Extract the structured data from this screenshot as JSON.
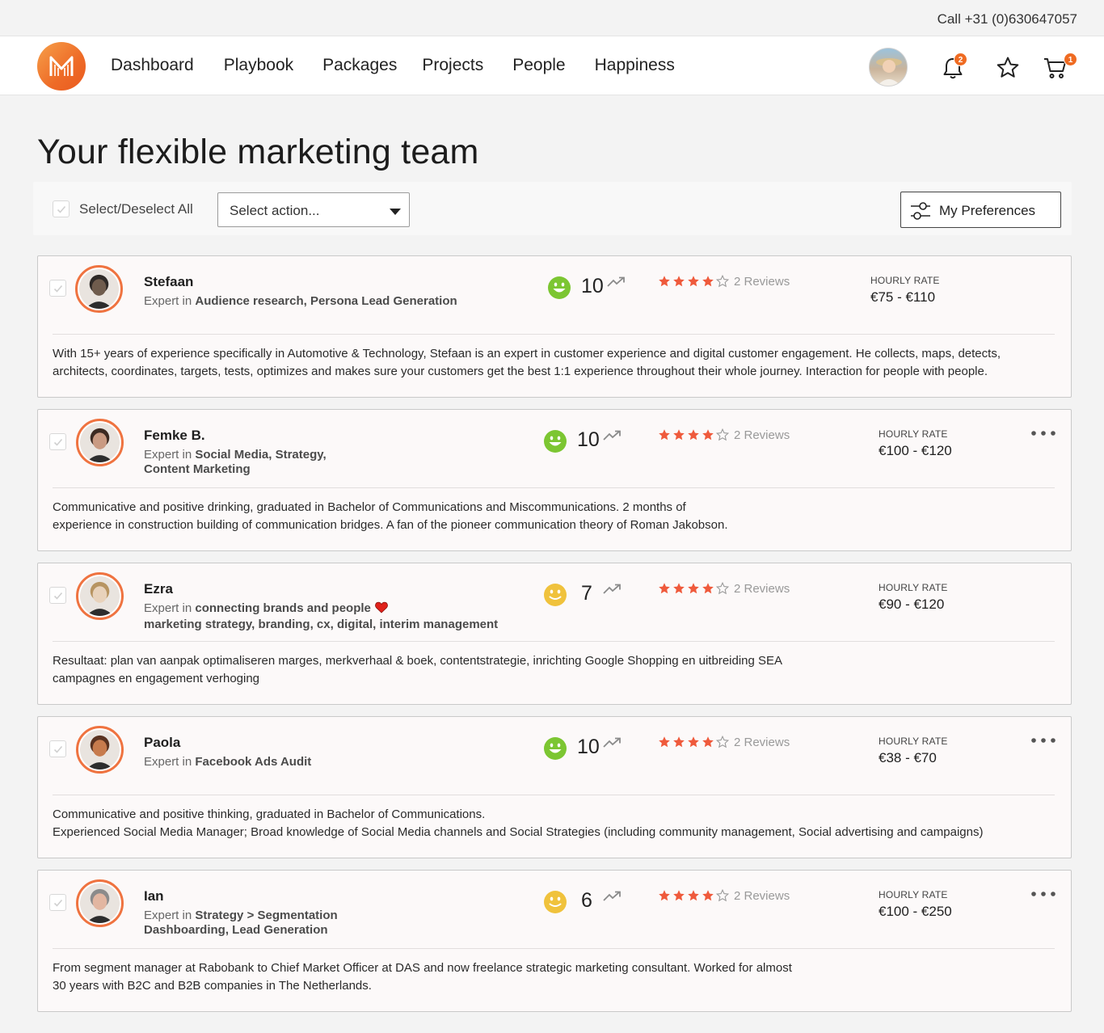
{
  "topbar": {
    "call": "Call +31 (0)630647057"
  },
  "nav": {
    "links": [
      "Dashboard",
      "Playbook",
      "Packages",
      "Projects",
      "People",
      "Happiness"
    ],
    "notifications_count": "2",
    "cart_count": "1",
    "accent": "#ef6b22"
  },
  "page": {
    "title": "Your flexible marketing team"
  },
  "toolbar": {
    "select_all": "Select/Deselect All",
    "action_placeholder": "Select action...",
    "preferences": "My Preferences"
  },
  "labels": {
    "hourly_rate": "HOURLY RATE",
    "expert_in": "Expert in"
  },
  "people": [
    {
      "name": "Stefaan",
      "expertise": [
        "Audience research, Persona Lead Generation"
      ],
      "happiness_score": "10",
      "mood": "happy",
      "rating": 4,
      "reviews": "2 Reviews",
      "rate": "€75 - €110",
      "has_menu": false,
      "description": "With 15+ years of experience specifically in Automotive & Technology, Stefaan is an expert in customer experience and digital customer engagement. He collects, maps, detects, architects, coordinates, targets, tests, optimizes and makes sure your customers get the best 1:1 experience throughout their whole journey. Interaction for people with people."
    },
    {
      "name": "Femke B.",
      "expertise": [
        "Social Media, Strategy,",
        "Content Marketing"
      ],
      "happiness_score": "10",
      "mood": "happy",
      "rating": 4,
      "reviews": "2 Reviews",
      "rate": "€100 - €120",
      "has_menu": true,
      "description": "Communicative and positive drinking, graduated in Bachelor of Communications and Miscommunications.  2 months of experience in construction building of communication bridges. A fan of the pioneer communication theory of Roman Jakobson."
    },
    {
      "name": "Ezra",
      "expertise": [
        "connecting brands and people",
        "marketing strategy, branding, cx, digital, interim management"
      ],
      "happiness_score": "7",
      "mood": "neutral",
      "rating": 4,
      "reviews": "2 Reviews",
      "rate": "€90 - €120",
      "has_menu": false,
      "description": "Resultaat: plan van aanpak optimaliseren marges, merkverhaal & boek, contentstrategie, inrichting Google Shopping en uitbreiding SEA campagnes en engagement verhoging"
    },
    {
      "name": "Paola",
      "expertise": [
        "Facebook Ads Audit"
      ],
      "happiness_score": "10",
      "mood": "happy",
      "rating": 4,
      "reviews": "2 Reviews",
      "rate": "€38 - €70",
      "has_menu": true,
      "description": "Communicative and positive thinking, graduated in Bachelor of Communications.\nExperienced Social Media Manager; Broad knowledge of Social Media channels and Social Strategies (including community management, Social advertising and campaigns)"
    },
    {
      "name": "Ian",
      "expertise": [
        "Strategy > Segmentation",
        "Dashboarding, Lead Generation"
      ],
      "happiness_score": "6",
      "mood": "neutral",
      "rating": 4,
      "reviews": "2 Reviews",
      "rate": "€100 - €250",
      "has_menu": true,
      "description": "From segment manager at Rabobank to Chief Market Officer at DAS and now freelance strategic marketing consultant. Worked for almost 30 years with B2C and B2B companies in The Netherlands."
    }
  ]
}
